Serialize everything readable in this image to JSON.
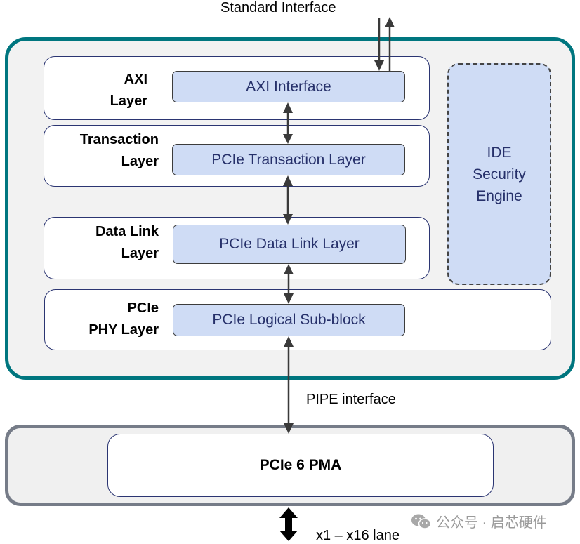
{
  "diagram": {
    "top_label": "Standard Interface",
    "layers": [
      {
        "label_lines": [
          "AXI",
          "Layer"
        ],
        "block": "AXI Interface"
      },
      {
        "label_lines": [
          "Transaction",
          "Layer"
        ],
        "block": "PCIe Transaction Layer"
      },
      {
        "label_lines": [
          "Data Link",
          "Layer"
        ],
        "block": "PCIe Data Link Layer"
      },
      {
        "label_lines": [
          "PCIe",
          "PHY Layer"
        ],
        "block": "PCIe Logical Sub-block"
      }
    ],
    "ide_engine": {
      "lines": [
        "IDE",
        "Security",
        "Engine"
      ]
    },
    "pipe_label": "PIPE interface",
    "pma_label": "PCIe 6 PMA",
    "lane_label": "x1 – x16 lane",
    "watermark": "公众号 · 启芯硬件",
    "watermark_icon": "wechat-icon",
    "colors": {
      "controller_border": "#00767f",
      "phy_container_border": "#767c88",
      "block_fill": "#cfdcf5",
      "layer_border": "#2b3572",
      "block_text": "#26306a"
    }
  }
}
